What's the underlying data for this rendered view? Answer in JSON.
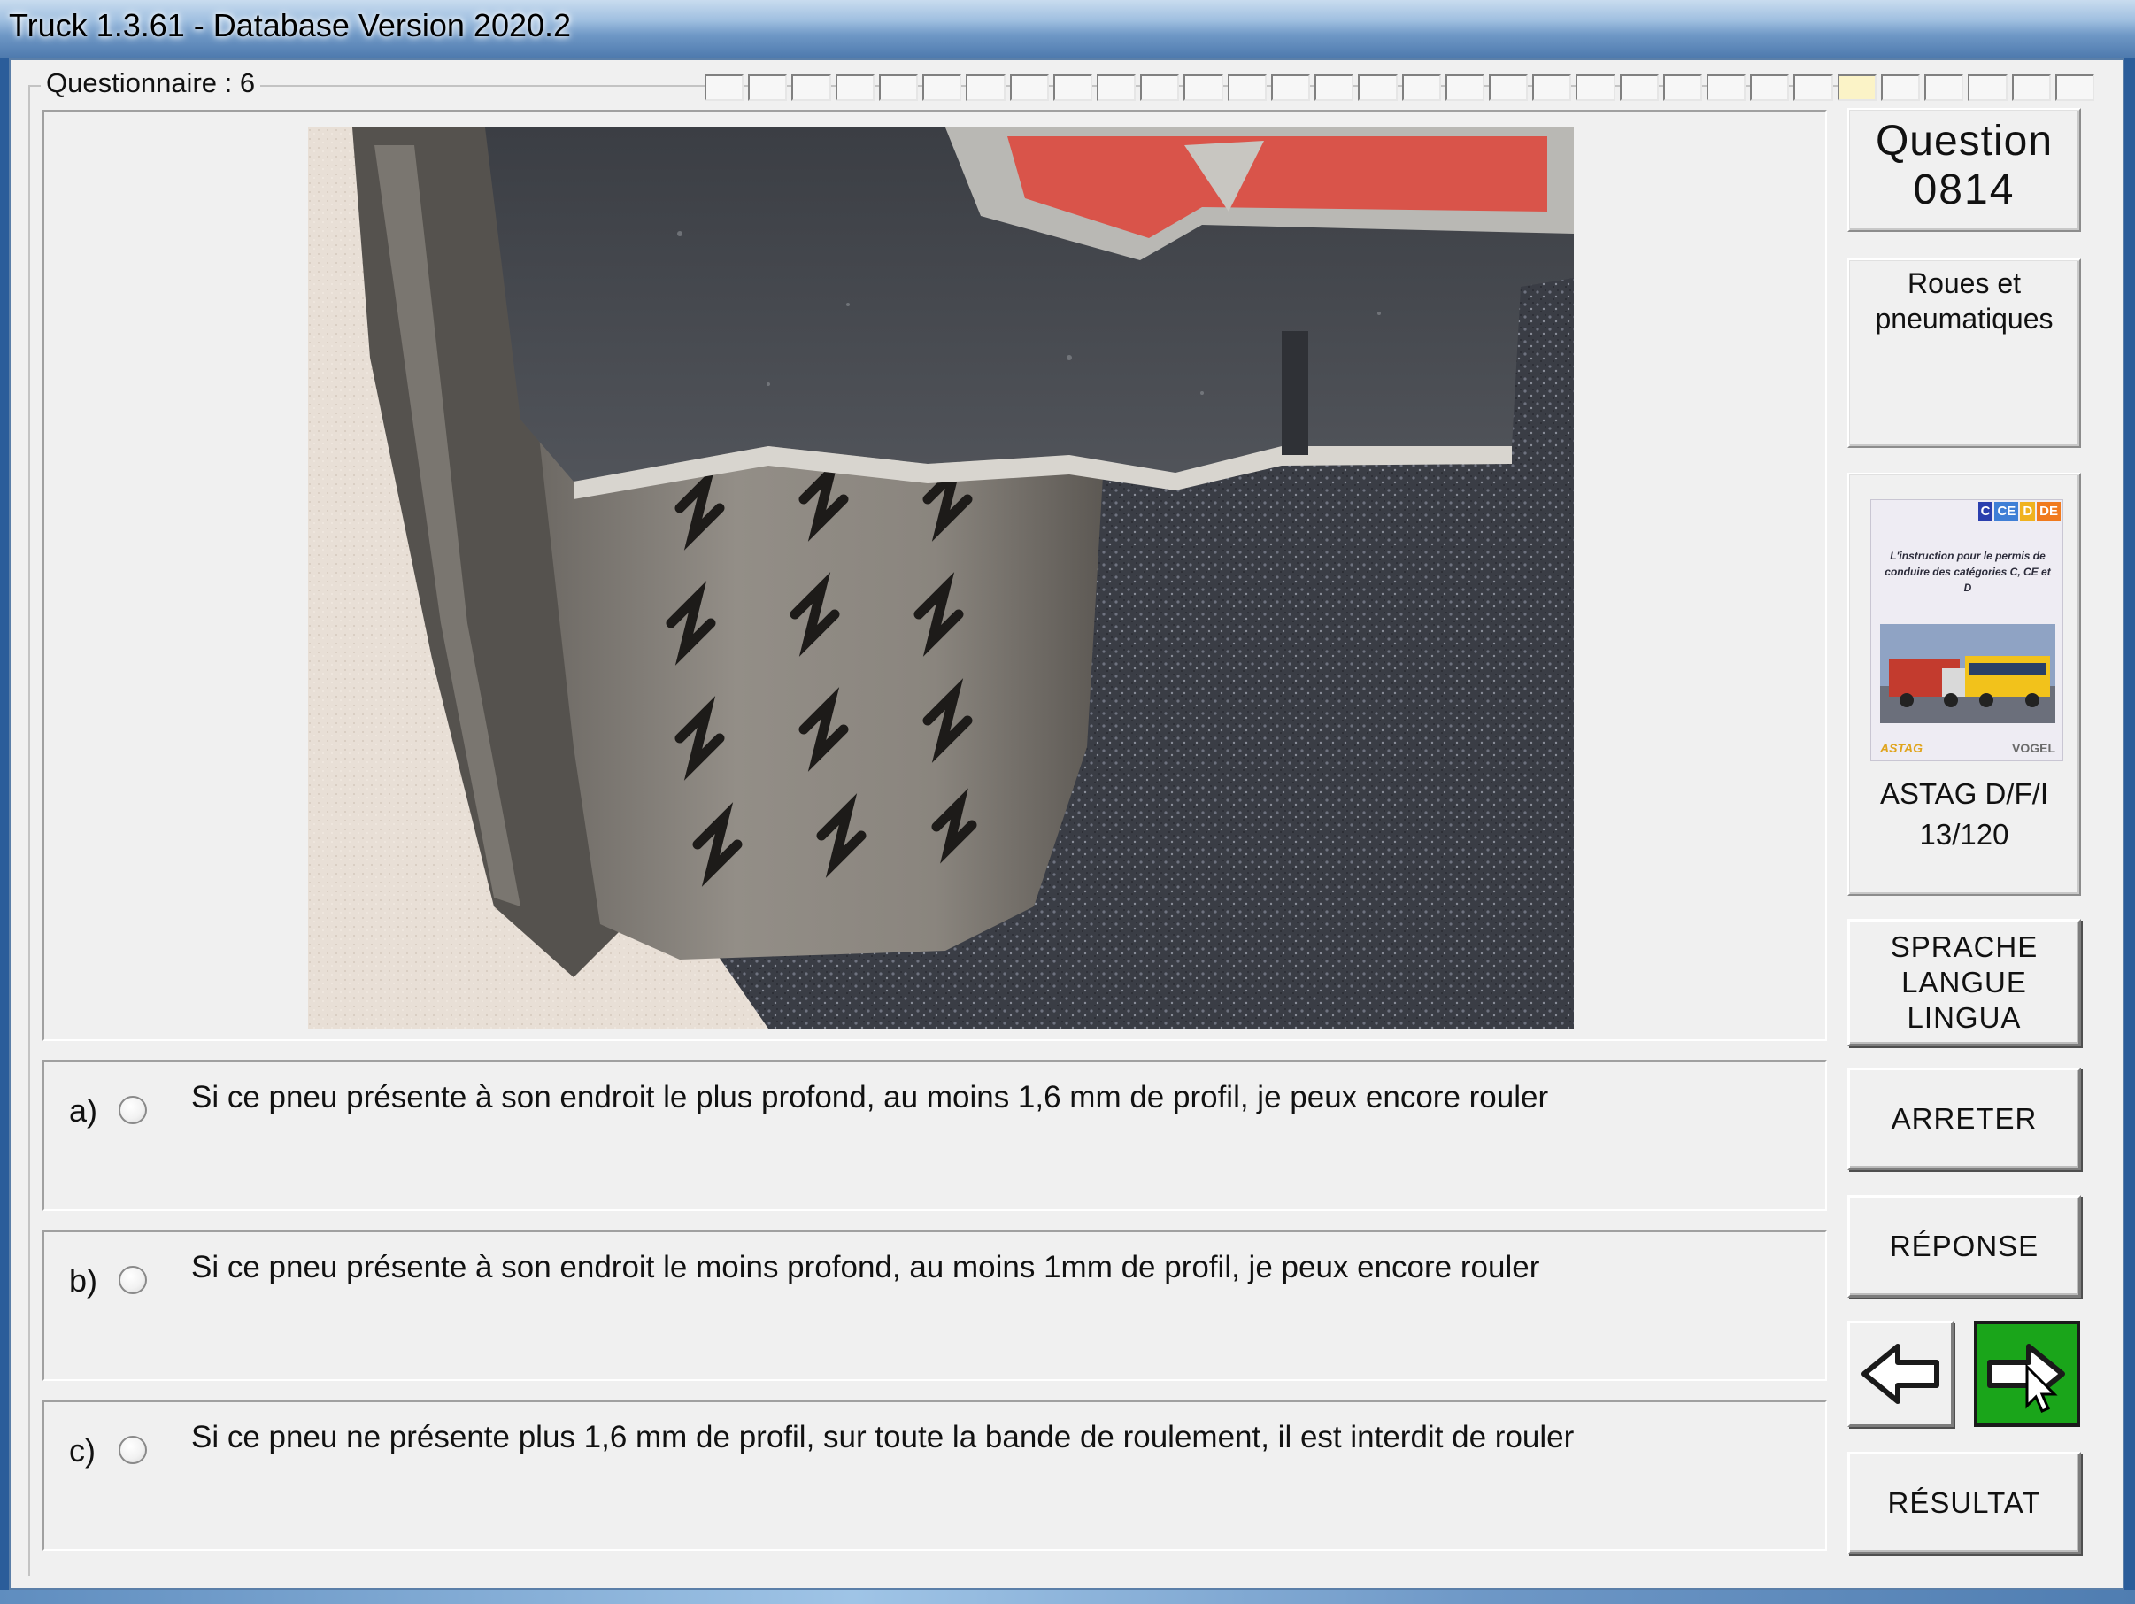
{
  "window": {
    "title": "Truck 1.3.61 - Database Version 2020.2"
  },
  "questionnaire": {
    "label": "Questionnaire : 6",
    "segments_total": 32,
    "current_segment": 27
  },
  "question": {
    "label": "Question",
    "number": "0814",
    "category": "Roues et pneumatiques"
  },
  "book": {
    "badges": [
      {
        "text": "C",
        "color": "#2b3fae"
      },
      {
        "text": "CE",
        "color": "#3f7fd6"
      },
      {
        "text": "D",
        "color": "#f0b21e"
      },
      {
        "text": "DE",
        "color": "#f07a1e"
      }
    ],
    "cover_text": "L'instruction pour le permis de conduire des catégories C, CE et D",
    "publisher_left": "ASTAG",
    "publisher_right": "VOGEL",
    "caption_line1": "ASTAG D/F/I",
    "caption_line2": "13/120"
  },
  "answers": [
    {
      "letter": "a)",
      "text": "Si ce pneu présente à son endroit le plus profond, au moins 1,6 mm de profil, je peux encore rouler"
    },
    {
      "letter": "b)",
      "text": "Si ce pneu présente à son endroit le moins profond, au moins 1mm de profil, je peux encore rouler"
    },
    {
      "letter": "c)",
      "text": "Si ce pneu ne présente plus 1,6 mm de profil, sur toute la bande de roulement, il est interdit de rouler"
    }
  ],
  "buttons": {
    "language_line1": "SPRACHE",
    "language_line2": "LANGUE",
    "language_line3": "LINGUA",
    "stop": "ARRETER",
    "answer": "RÉPONSE",
    "result": "RÉSULTAT"
  },
  "nav": {
    "prev_icon": "arrow-left-icon",
    "next_icon": "arrow-right-icon",
    "next_highlight": "#1aa51a"
  }
}
